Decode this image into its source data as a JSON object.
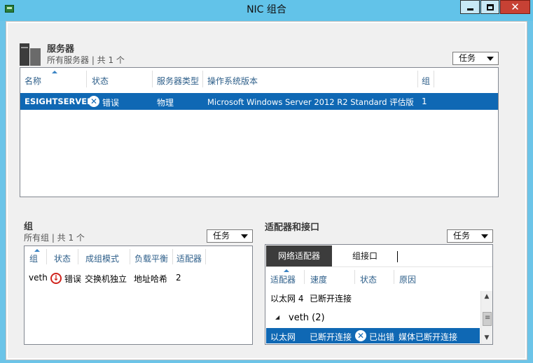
{
  "window": {
    "title": "NIC 组合",
    "close_glyph": "✕"
  },
  "servers": {
    "title": "服务器",
    "subtitle": "所有服务器 | 共 1 个",
    "tasks_label": "任务",
    "columns": [
      "名称",
      "状态",
      "服务器类型",
      "操作系统版本",
      "组"
    ],
    "rows": [
      {
        "name": "ESIGHTSERVER",
        "status": "错误",
        "type": "物理",
        "os": "Microsoft Windows Server 2012 R2 Standard 评估版",
        "group": "1"
      }
    ]
  },
  "groups": {
    "title": "组",
    "subtitle": "所有组 | 共 1 个",
    "tasks_label": "任务",
    "columns": [
      "组",
      "状态",
      "成组模式",
      "负载平衡",
      "适配器"
    ],
    "rows": [
      {
        "group": "veth",
        "status": "错误",
        "mode": "交换机独立",
        "balance": "地址哈希",
        "adapters": "2"
      }
    ]
  },
  "adapters": {
    "title": "适配器和接口",
    "tasks_label": "任务",
    "tabs": [
      "网络适配器",
      "组接口"
    ],
    "columns": [
      "适配器",
      "速度",
      "状态",
      "原因"
    ],
    "rows": [
      {
        "adapter": "以太网 4",
        "speed": "已断开连接",
        "status": "",
        "reason": ""
      }
    ],
    "group_header": "veth (2)",
    "group_rows": [
      {
        "adapter": "以太网",
        "speed": "已断开连接",
        "status": "已出错",
        "reason": "媒体已断开连接"
      }
    ]
  },
  "icons": {
    "error_x": "✕",
    "error_down": "↓",
    "expand_triangle": "◢",
    "scroll_up": "▲",
    "scroll_down": "▼",
    "scroll_grip": "≡"
  }
}
